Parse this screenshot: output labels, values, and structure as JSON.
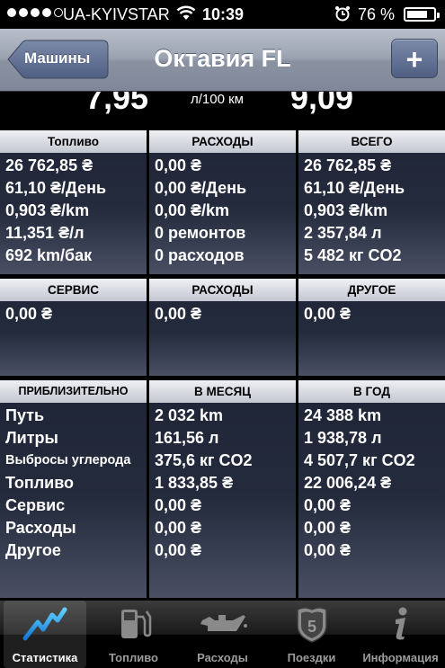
{
  "status": {
    "carrier": "UA-KYIVSTAR",
    "time": "10:39",
    "battery": "76 %"
  },
  "nav": {
    "back_label": "Машины",
    "title": "Октавия FL",
    "add_label": "+"
  },
  "top": {
    "value1": "7,95",
    "unit": "л/100 км",
    "value2": "9,09"
  },
  "section1": {
    "headers": [
      "Топливо",
      "РАСХОДЫ",
      "ВСЕГО"
    ],
    "col1": [
      "26 762,85 ₴",
      "61,10 ₴/День",
      "0,903 ₴/km",
      "11,351 ₴/л",
      "692 km/бак"
    ],
    "col2": [
      "0,00 ₴",
      "0,00 ₴/День",
      "0,00 ₴/km",
      "0 ремонтов",
      "0 расходов"
    ],
    "col3": [
      "26 762,85 ₴",
      "61,10 ₴/День",
      "0,903 ₴/km",
      "2 357,84 л",
      "5 482 кг CO2"
    ]
  },
  "section2": {
    "headers": [
      "СЕРВИС",
      "РАСХОДЫ",
      "ДРУГОЕ"
    ],
    "col1": [
      "0,00 ₴"
    ],
    "col2": [
      "0,00 ₴"
    ],
    "col3": [
      "0,00 ₴"
    ]
  },
  "section3": {
    "headers": [
      "ПРИБЛИЗИТЕЛЬНО",
      "В МЕСЯЦ",
      "В ГОД"
    ],
    "col1": [
      "Путь",
      "Литры",
      "Выбросы углерода",
      "Топливо",
      "Сервис",
      "Расходы",
      "Другое"
    ],
    "col2": [
      "2 032 km",
      "161,56 л",
      "375,6 кг CO2",
      "1 833,85 ₴",
      "0,00 ₴",
      "0,00 ₴",
      "0,00 ₴"
    ],
    "col3": [
      "24 388 km",
      "1 938,78 л",
      "4 507,7 кг CO2",
      "22 006,24 ₴",
      "0,00 ₴",
      "0,00 ₴",
      "0,00 ₴"
    ]
  },
  "tabs": [
    {
      "label": "Статистика",
      "icon": "chart-icon",
      "active": true
    },
    {
      "label": "Топливо",
      "icon": "fuel-pump-icon",
      "active": false
    },
    {
      "label": "Расходы",
      "icon": "oil-can-icon",
      "active": false
    },
    {
      "label": "Поездки",
      "icon": "route-sign-icon",
      "active": false
    },
    {
      "label": "Информация",
      "icon": "info-icon",
      "active": false
    }
  ]
}
